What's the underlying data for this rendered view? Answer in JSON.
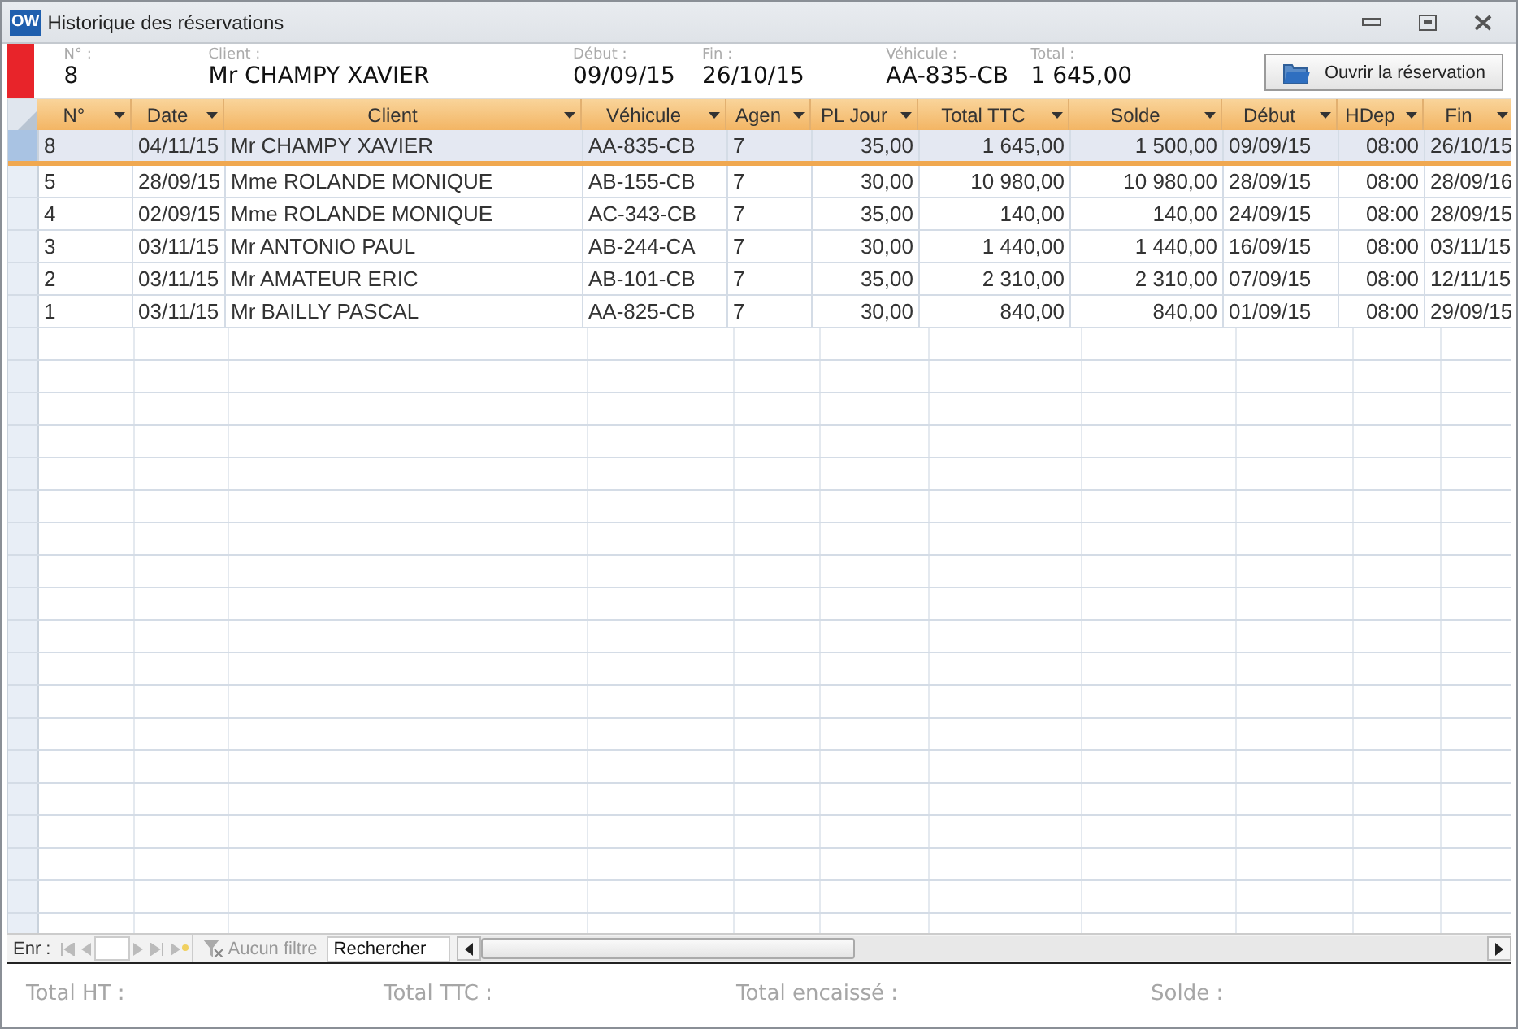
{
  "window": {
    "app_icon": "OW",
    "title": "Historique des réservations"
  },
  "summary": {
    "fields": [
      {
        "label": "N° :",
        "value": "8"
      },
      {
        "label": "Client :",
        "value": "Mr CHAMPY XAVIER"
      },
      {
        "label": "Début :",
        "value": "09/09/15"
      },
      {
        "label": "Fin :",
        "value": "26/10/15"
      },
      {
        "label": "Véhicule :",
        "value": "AA-835-CB"
      },
      {
        "label": "Total :",
        "value": "1 645,00"
      }
    ],
    "open_button": "Ouvrir la réservation"
  },
  "table": {
    "columns": [
      {
        "label": "N°",
        "kind": "text"
      },
      {
        "label": "Date",
        "kind": "text"
      },
      {
        "label": "Client",
        "kind": "text"
      },
      {
        "label": "Véhicule",
        "kind": "text"
      },
      {
        "label": "Agen",
        "kind": "text"
      },
      {
        "label": "PL Jour",
        "kind": "number"
      },
      {
        "label": "Total TTC",
        "kind": "number"
      },
      {
        "label": "Solde",
        "kind": "number"
      },
      {
        "label": "Début",
        "kind": "text"
      },
      {
        "label": "HDep",
        "kind": "number"
      },
      {
        "label": "Fin",
        "kind": "text"
      }
    ],
    "rows": [
      {
        "selected": true,
        "cells": [
          "8",
          "04/11/15",
          "Mr CHAMPY XAVIER",
          "AA-835-CB",
          "7",
          "35,00",
          "1 645,00",
          "1 500,00",
          "09/09/15",
          "08:00",
          "26/10/15"
        ]
      },
      {
        "selected": false,
        "cells": [
          "5",
          "28/09/15",
          "Mme ROLANDE MONIQUE",
          "AB-155-CB",
          "7",
          "30,00",
          "10 980,00",
          "10 980,00",
          "28/09/15",
          "08:00",
          "28/09/16"
        ]
      },
      {
        "selected": false,
        "cells": [
          "4",
          "02/09/15",
          "Mme ROLANDE MONIQUE",
          "AC-343-CB",
          "7",
          "35,00",
          "140,00",
          "140,00",
          "24/09/15",
          "08:00",
          "28/09/15"
        ]
      },
      {
        "selected": false,
        "cells": [
          "3",
          "03/11/15",
          "Mr ANTONIO PAUL",
          "AB-244-CA",
          "7",
          "30,00",
          "1 440,00",
          "1 440,00",
          "16/09/15",
          "08:00",
          "03/11/15"
        ]
      },
      {
        "selected": false,
        "cells": [
          "2",
          "03/11/15",
          "Mr AMATEUR ERIC",
          "AB-101-CB",
          "7",
          "35,00",
          "2 310,00",
          "2 310,00",
          "07/09/15",
          "08:00",
          "12/11/15"
        ]
      },
      {
        "selected": false,
        "cells": [
          "1",
          "03/11/15",
          "Mr BAILLY PASCAL",
          "AA-825-CB",
          "7",
          "30,00",
          "840,00",
          "840,00",
          "01/09/15",
          "08:00",
          "29/09/15"
        ]
      }
    ]
  },
  "navigation": {
    "label": "Enr :",
    "filter": "Aucun filtre",
    "search_placeholder": "Rechercher"
  },
  "totals": [
    "Total HT :",
    "Total TTC :",
    "Total encaissé :",
    "Solde :"
  ]
}
